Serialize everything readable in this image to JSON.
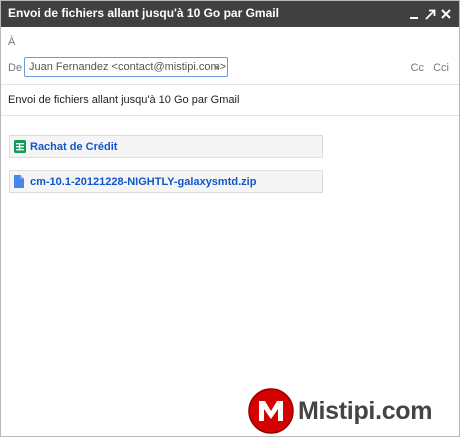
{
  "window": {
    "title": "Envoi de fichiers allant jusqu'à 10 Go par Gmail",
    "controls": [
      "minimize-icon",
      "popout-icon",
      "close-icon"
    ]
  },
  "compose": {
    "to_label": "À",
    "from_label": "De",
    "from_value": "Juan Fernandez <contact@mistipi.com>",
    "cc_label": "Cc",
    "bcc_label": "Cci",
    "subject": "Envoi de fichiers allant jusqu'à 10 Go par Gmail"
  },
  "attachments": [
    {
      "name": "Rachat de Crédit",
      "icon": "google-sheets-icon",
      "icon_color": "#0f9d58"
    },
    {
      "name": "cm-10.1-20121228-NIGHTLY-galaxysmtd.zip",
      "icon": "file-icon",
      "icon_color": "#4a86e8"
    }
  ],
  "watermark": {
    "text": "Mistipi.com",
    "logo_color": "#d50000"
  },
  "colors": {
    "titlebar": "#404040",
    "link": "#1155cc",
    "focus_border": "#6b9bd6"
  }
}
